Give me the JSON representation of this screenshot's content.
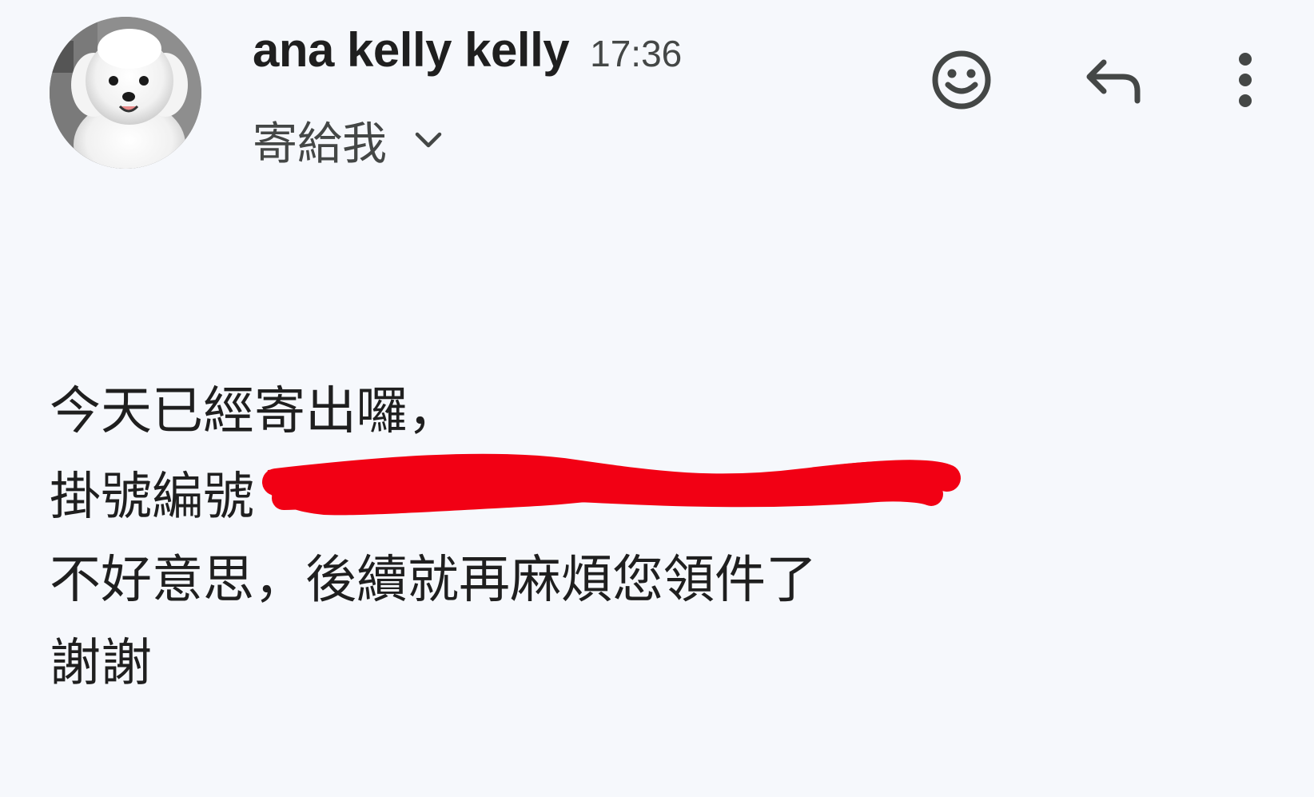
{
  "sender": {
    "name": "ana kelly kelly",
    "time": "17:36"
  },
  "recipient": {
    "label": "寄給我"
  },
  "icons": {
    "avatar": "dog-avatar",
    "emoji": "add-reaction-icon",
    "reply": "reply-icon",
    "more": "more-vert-icon",
    "expand": "chevron-down-icon"
  },
  "colors": {
    "background": "#f6f8fc",
    "text": "#1f1f1f",
    "secondary": "#444746",
    "redaction": "#f20014"
  },
  "message": {
    "lines": [
      "今天已經寄出囉，",
      "掛號編號",
      "不好意思，後續就再麻煩您領件了",
      "謝謝"
    ]
  }
}
